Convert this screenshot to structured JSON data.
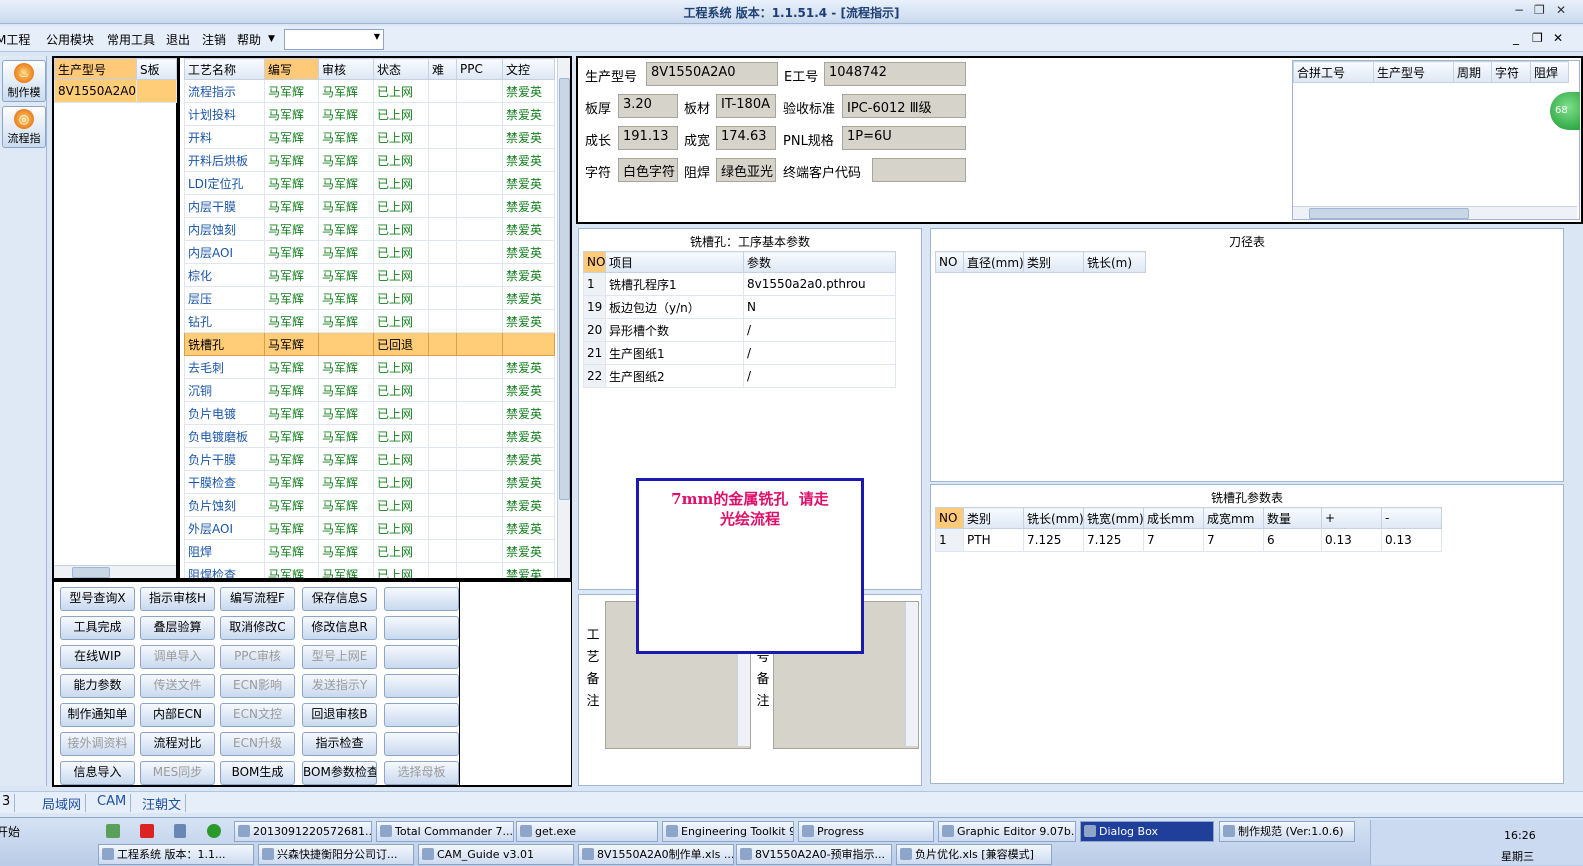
{
  "window": {
    "title": "工程系统   版本：1.1.51.4 - [流程指示]"
  },
  "menubar": {
    "items": [
      "M工程",
      "公用模块",
      "常用工具",
      "退出",
      "注销",
      "帮助"
    ],
    "combo_value": ""
  },
  "leftnav": {
    "items": [
      "制作模块",
      "流程指示"
    ]
  },
  "model_list": {
    "headers": [
      "生产型号",
      "S板"
    ],
    "rows": [
      [
        "8V1550A2A0",
        ""
      ]
    ]
  },
  "process_table": {
    "headers": [
      "工艺名称",
      "编写",
      "审核",
      "状态",
      "难",
      "PPC",
      "文控"
    ],
    "rows": [
      [
        "流程指示",
        "马军辉",
        "马军辉",
        "已上网",
        "",
        "",
        "禁爱英"
      ],
      [
        "计划投料",
        "马军辉",
        "马军辉",
        "已上网",
        "",
        "",
        "禁爱英"
      ],
      [
        "开料",
        "马军辉",
        "马军辉",
        "已上网",
        "",
        "",
        "禁爱英"
      ],
      [
        "开料后烘板",
        "马军辉",
        "马军辉",
        "已上网",
        "",
        "",
        "禁爱英"
      ],
      [
        "LDI定位孔",
        "马军辉",
        "马军辉",
        "已上网",
        "",
        "",
        "禁爱英"
      ],
      [
        "内层干膜",
        "马军辉",
        "马军辉",
        "已上网",
        "",
        "",
        "禁爱英"
      ],
      [
        "内层蚀刻",
        "马军辉",
        "马军辉",
        "已上网",
        "",
        "",
        "禁爱英"
      ],
      [
        "内层AOI",
        "马军辉",
        "马军辉",
        "已上网",
        "",
        "",
        "禁爱英"
      ],
      [
        "棕化",
        "马军辉",
        "马军辉",
        "已上网",
        "",
        "",
        "禁爱英"
      ],
      [
        "层压",
        "马军辉",
        "马军辉",
        "已上网",
        "",
        "",
        "禁爱英"
      ],
      [
        "钻孔",
        "马军辉",
        "马军辉",
        "已上网",
        "",
        "",
        "禁爱英"
      ],
      [
        "铣槽孔",
        "马军辉",
        "",
        "已回退",
        "",
        "",
        ""
      ],
      [
        "去毛刺",
        "马军辉",
        "马军辉",
        "已上网",
        "",
        "",
        "禁爱英"
      ],
      [
        "沉铜",
        "马军辉",
        "马军辉",
        "已上网",
        "",
        "",
        "禁爱英"
      ],
      [
        "负片电镀",
        "马军辉",
        "马军辉",
        "已上网",
        "",
        "",
        "禁爱英"
      ],
      [
        "负电镀磨板",
        "马军辉",
        "马军辉",
        "已上网",
        "",
        "",
        "禁爱英"
      ],
      [
        "负片干膜",
        "马军辉",
        "马军辉",
        "已上网",
        "",
        "",
        "禁爱英"
      ],
      [
        "干膜检查",
        "马军辉",
        "马军辉",
        "已上网",
        "",
        "",
        "禁爱英"
      ],
      [
        "负片蚀刻",
        "马军辉",
        "马军辉",
        "已上网",
        "",
        "",
        "禁爱英"
      ],
      [
        "外层AOI",
        "马军辉",
        "马军辉",
        "已上网",
        "",
        "",
        "禁爱英"
      ],
      [
        "阻焊",
        "马军辉",
        "马军辉",
        "已上网",
        "",
        "",
        "禁爱英"
      ],
      [
        "阻焊检查",
        "马军辉",
        "马军辉",
        "已上网",
        "",
        "",
        "禁爱英"
      ]
    ]
  },
  "info": {
    "labels": {
      "model": "生产型号",
      "eno": "E工号",
      "thickness": "板厚",
      "material": "板材",
      "standard": "验收标准",
      "length": "成长",
      "width": "成宽",
      "pnl": "PNL规格",
      "legend": "字符",
      "mask": "阻焊",
      "customer_code": "终端客户代码"
    },
    "values": {
      "model": "8V1550A2A0",
      "eno": "1048742",
      "thickness": "3.20",
      "material": "IT-180A",
      "standard": "IPC-6012 Ⅲ级",
      "length": "191.13",
      "width": "174.63",
      "pnl": "1P=6U",
      "legend": "白色字符",
      "mask": "绿色亚光",
      "customer_code": ""
    }
  },
  "merge_table": {
    "headers": [
      "合拼工号",
      "生产型号",
      "周期",
      "字符",
      "阻焊"
    ]
  },
  "badge": "68",
  "basic_params": {
    "title": "铣槽孔：工序基本参数",
    "headers": [
      "NO",
      "项目",
      "参数"
    ],
    "rows": [
      [
        "1",
        "铣槽孔程序1",
        "8v1550a2a0.pthrou"
      ],
      [
        "19",
        "板边包边（y/n）",
        "N"
      ],
      [
        "20",
        "异形槽个数",
        "/"
      ],
      [
        "21",
        "生产图纸1",
        "/"
      ],
      [
        "22",
        "生产图纸2",
        "/"
      ]
    ]
  },
  "tool_table": {
    "title": "刀径表",
    "headers": [
      "NO",
      "直径(mm)",
      "类别",
      "铣长(m)"
    ]
  },
  "slot_table": {
    "title": "铣槽孔参数表",
    "headers": [
      "NO",
      "类别",
      "铣长(mm)",
      "铣宽(mm)",
      "成长mm",
      "成宽mm",
      "数量",
      "+",
      "-"
    ],
    "rows": [
      [
        "1",
        "PTH",
        "7.125",
        "7.125",
        "7",
        "7",
        "6",
        "0.13",
        "0.13"
      ]
    ]
  },
  "notes": {
    "process_note": "工\n艺\n备\n注",
    "model_note": "号\n备\n注"
  },
  "dialog": {
    "message": "7mm的金属铣孔  请走\n光绘流程"
  },
  "buttons": [
    [
      "型号查询X",
      "指示审核H",
      "编写流程F",
      "保存信息S",
      ""
    ],
    [
      "工具完成",
      "叠层验算",
      "取消修改C",
      "修改信息R",
      ""
    ],
    [
      "在线WIP",
      "调单导入",
      "PPC审核",
      "型号上网E",
      ""
    ],
    [
      "能力参数",
      "传送文件",
      "ECN影响",
      "发送指示Y",
      ""
    ],
    [
      "制作通知单",
      "内部ECN",
      "ECN文控",
      "回退审核B",
      ""
    ],
    [
      "接外调资料",
      "流程对比",
      "ECN升级",
      "指示检查",
      ""
    ],
    [
      "信息导入",
      "MES同步",
      "BOM生成",
      "BOM参数检查",
      "选择母板"
    ]
  ],
  "disabled_buttons": [
    "调单导入",
    "PPC审核",
    "型号上网E",
    "传送文件",
    "ECN影响",
    "发送指示Y",
    "ECN文控",
    "接外调资料",
    "ECN升级",
    "MES同步",
    "选择母板"
  ],
  "statusbar": {
    "left": "3",
    "tabs": [
      "局域网",
      "CAM",
      "汪朝文"
    ]
  },
  "taskbar": {
    "start": "开始",
    "row1": [
      "2013091220572681...",
      "Total Commander 7....",
      "get.exe",
      "Engineering Toolkit 9....",
      "Progress",
      "Graphic Editor 9.07b...",
      "Dialog Box",
      "制作规范 (Ver:1.0.6)"
    ],
    "row2": [
      "工程系统  版本：1.1...",
      "兴森快捷衡阳分公司订...",
      "CAM_Guide v3.01",
      "8V1550A2A0制作单.xls ...",
      "8V1550A2A0-预审指示...",
      "负片优化.xls [兼容模式]"
    ],
    "clock": "16:26",
    "weekday": "星期三"
  }
}
